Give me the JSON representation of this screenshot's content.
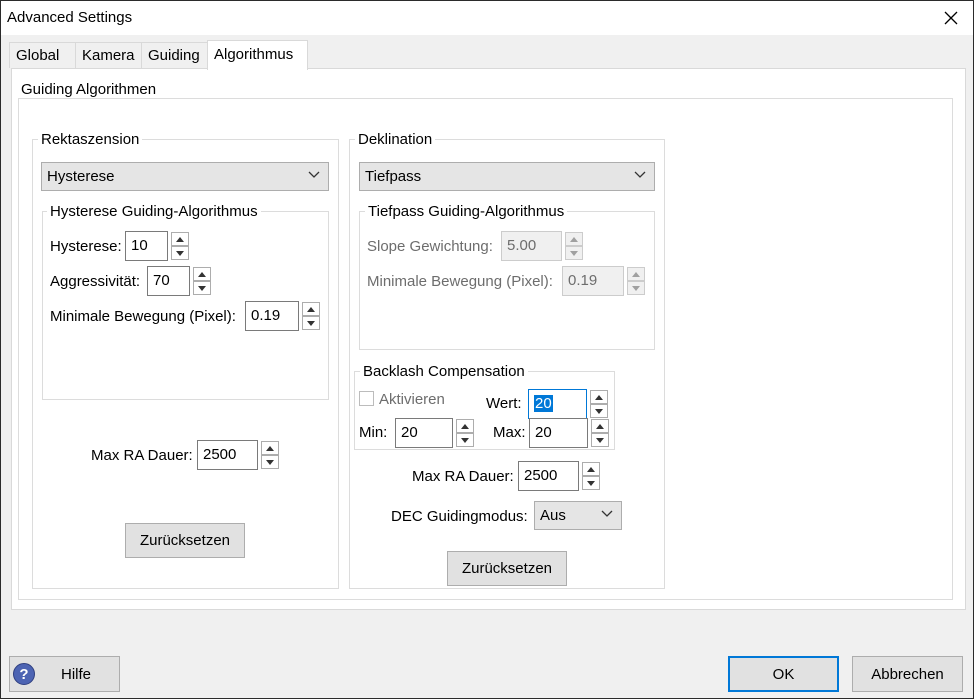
{
  "window": {
    "title": "Advanced Settings"
  },
  "tabs": [
    "Global",
    "Kamera",
    "Guiding",
    "Algorithmus"
  ],
  "active_tab": "Algorithmus",
  "main": {
    "group_title": "Guiding Algorithmen"
  },
  "ra": {
    "title": "Rektaszension",
    "algorithm": "Hysterese",
    "sub_title": "Hysterese Guiding-Algorithmus",
    "hysteresis_label": "Hysterese:",
    "hysteresis_value": "10",
    "aggr_label": "Aggressivität:",
    "aggr_value": "70",
    "minmove_label": "Minimale Bewegung (Pixel):",
    "minmove_value": "0.19",
    "max_dur_label": "Max RA Dauer:",
    "max_dur_value": "2500",
    "reset_label": "Zurücksetzen"
  },
  "dec": {
    "title": "Deklination",
    "algorithm": "Tiefpass",
    "sub_title": "Tiefpass Guiding-Algorithmus",
    "slope_label": "Slope Gewichtung:",
    "slope_value": "5.00",
    "minmove_label": "Minimale Bewegung (Pixel):",
    "minmove_value": "0.19",
    "backlash": {
      "title": "Backlash Compensation",
      "enable_label": "Aktivieren",
      "value_label": "Wert:",
      "value": "20",
      "min_label": "Min:",
      "min_value": "20",
      "max_label": "Max:",
      "max_value": "20"
    },
    "max_dur_label": "Max RA Dauer:",
    "max_dur_value": "2500",
    "mode_label": "DEC Guidingmodus:",
    "mode_value": "Aus",
    "reset_label": "Zurücksetzen"
  },
  "footer": {
    "help_label": "Hilfe",
    "ok_label": "OK",
    "cancel_label": "Abbrechen"
  },
  "colors": {
    "accent": "#0078d7",
    "help_icon": "#4d64b3"
  }
}
